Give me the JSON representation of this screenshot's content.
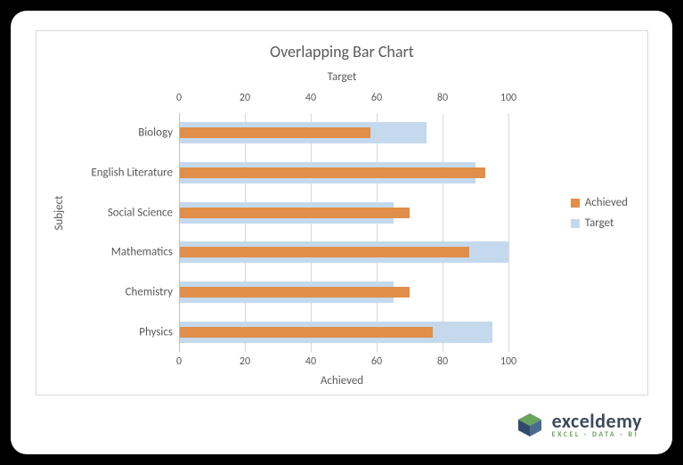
{
  "chart_data": {
    "type": "bar",
    "title": "Overlapping Bar Chart",
    "ylabel": "Subject",
    "top_axis_label": "Target",
    "bottom_axis_label": "Achieved",
    "xlim": [
      0,
      100
    ],
    "ticks": [
      0,
      20,
      40,
      60,
      80,
      100
    ],
    "categories": [
      "Biology",
      "English Literature",
      "Social Science",
      "Mathematics",
      "Chemistry",
      "Physics"
    ],
    "series": [
      {
        "name": "Target",
        "values": [
          75,
          90,
          65,
          100,
          65,
          95
        ]
      },
      {
        "name": "Achieved",
        "values": [
          58,
          93,
          70,
          88,
          70,
          77
        ]
      }
    ],
    "legend": [
      "Achieved",
      "Target"
    ]
  },
  "brand": {
    "name": "exceldemy",
    "tag": "EXCEL · DATA · BI"
  }
}
